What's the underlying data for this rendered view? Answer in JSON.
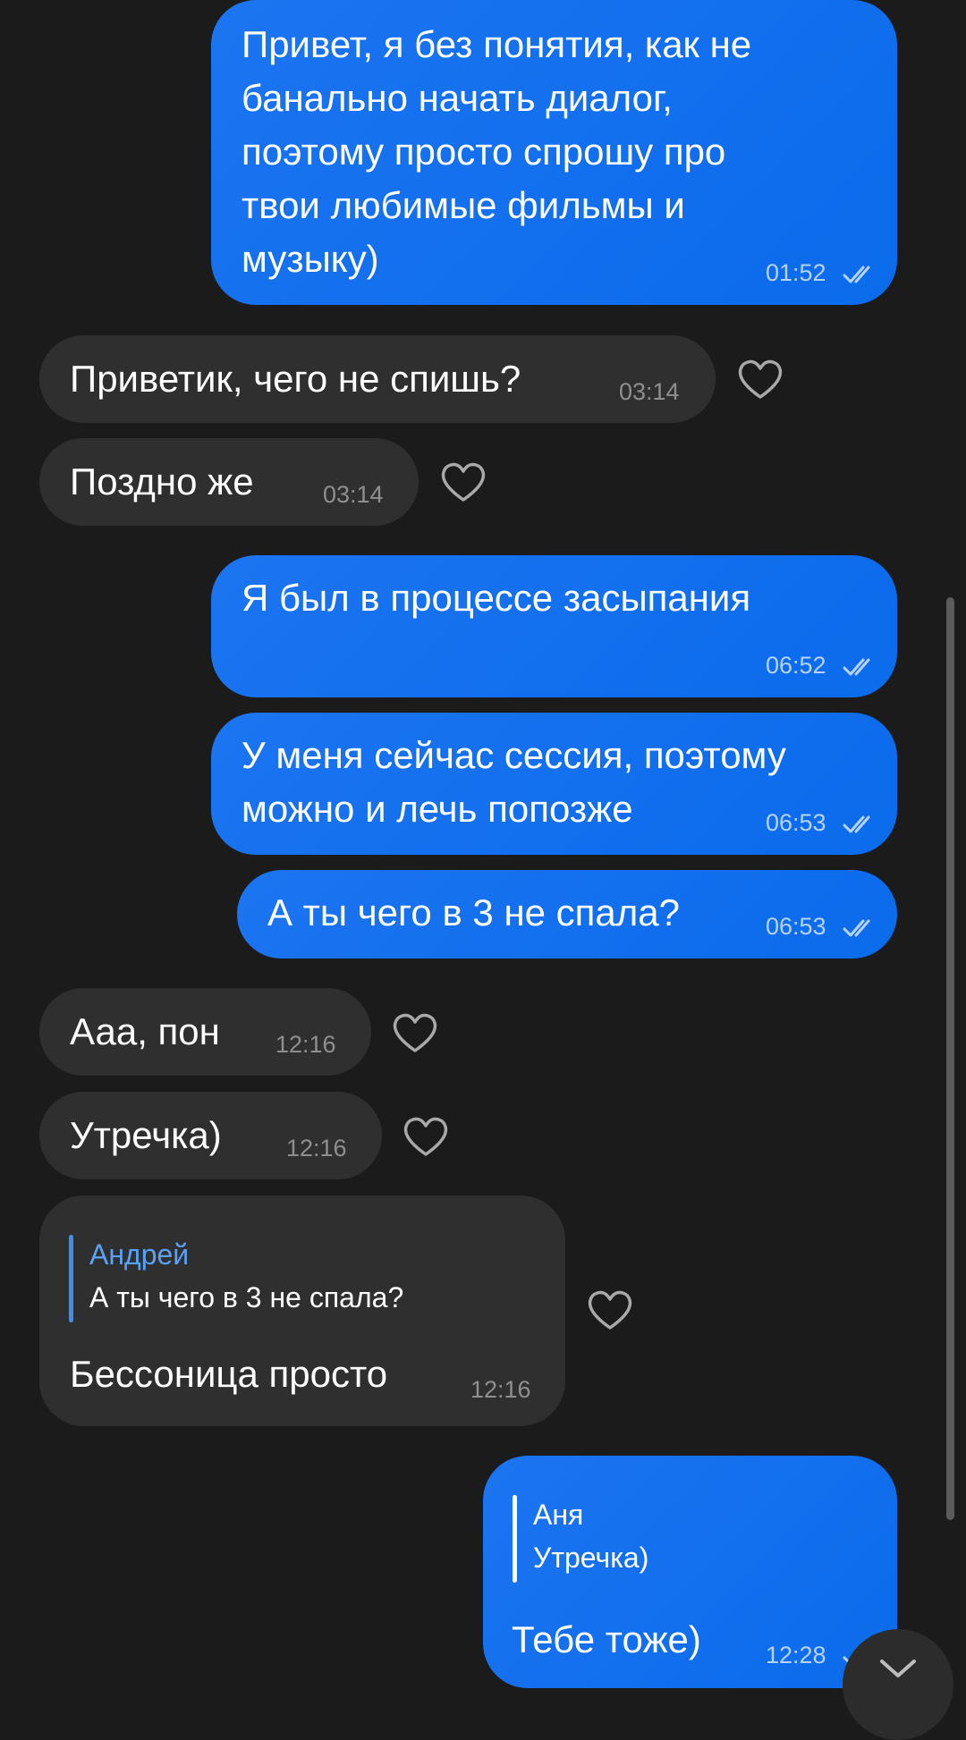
{
  "chat": {
    "messages": [
      {
        "id": "m1",
        "direction": "outgoing",
        "lines": [
          "Привет, я без понятия, как не",
          "банально начать диалог,",
          "поэтому просто спрошу про",
          "твои любимые фильмы и",
          "музыку)"
        ],
        "time": "01:52",
        "status": "read"
      },
      {
        "id": "m2",
        "direction": "incoming",
        "text": "Приветик, чего не спишь?",
        "time": "03:14",
        "reaction_icon": "heart-outline-icon"
      },
      {
        "id": "m3",
        "direction": "incoming",
        "text": "Поздно же",
        "time": "03:14",
        "reaction_icon": "heart-outline-icon"
      },
      {
        "id": "m4",
        "direction": "outgoing",
        "text": "Я был в процессе засыпания",
        "time": "06:52",
        "status": "read"
      },
      {
        "id": "m5",
        "direction": "outgoing",
        "lines": [
          "У меня сейчас сессия, поэтому",
          "можно и лечь попозже"
        ],
        "time": "06:53",
        "status": "read"
      },
      {
        "id": "m6",
        "direction": "outgoing",
        "text": "А ты чего в 3 не спала?",
        "time": "06:53",
        "status": "read"
      },
      {
        "id": "m7",
        "direction": "incoming",
        "text": "Ааа, пон",
        "time": "12:16",
        "reaction_icon": "heart-outline-icon"
      },
      {
        "id": "m8",
        "direction": "incoming",
        "text": "Утречка)",
        "time": "12:16",
        "reaction_icon": "heart-outline-icon"
      },
      {
        "id": "m9",
        "direction": "incoming",
        "reply": {
          "author": "Андрей",
          "text": "А ты чего в 3 не спала?"
        },
        "text": "Бессоница просто",
        "time": "12:16",
        "reaction_icon": "heart-outline-icon"
      },
      {
        "id": "m10",
        "direction": "outgoing",
        "reply": {
          "author": "Аня",
          "text": "Утречка)"
        },
        "text": "Тебе тоже)",
        "time": "12:28",
        "status": "read"
      }
    ]
  },
  "colors": {
    "background": "#1b1b1b",
    "outgoing_bubble": "#0d6cee",
    "incoming_bubble": "#2f2f2f",
    "reply_bar_incoming": "#3d8ef0",
    "reply_name_incoming": "#5aa2f5",
    "reply_bar_outgoing": "#ffffff"
  },
  "controls": {
    "scroll_down_icon": "chevron-down-icon",
    "read_status_icon": "double-check-icon"
  }
}
